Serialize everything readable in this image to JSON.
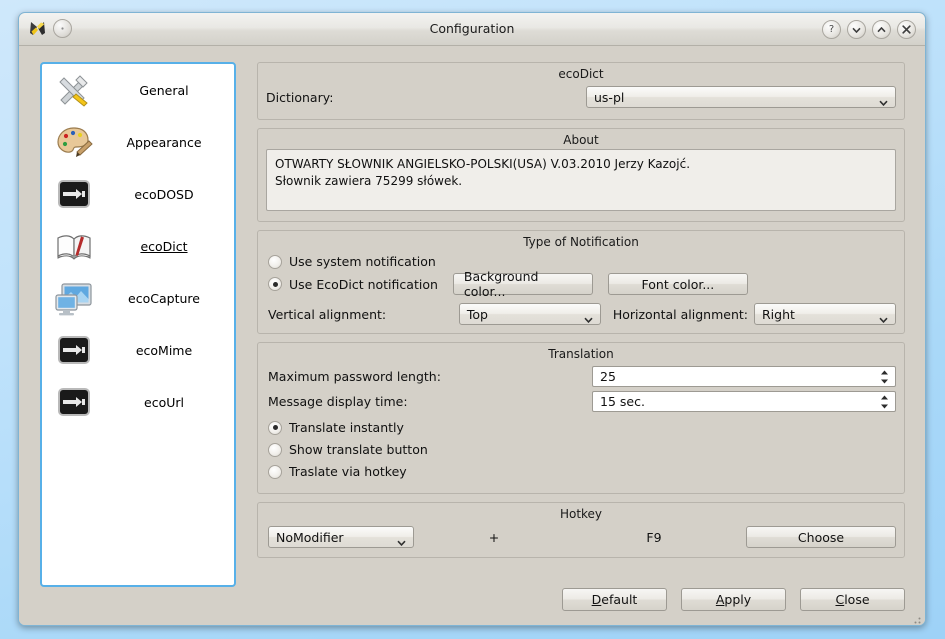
{
  "window": {
    "title": "Configuration",
    "titlebar_buttons": [
      {
        "name": "help-button",
        "glyph": "?"
      },
      {
        "name": "minimize-button",
        "glyph": "⌄"
      },
      {
        "name": "maximize-button",
        "glyph": "⌃"
      },
      {
        "name": "close-button",
        "glyph": "✕"
      }
    ]
  },
  "sidebar": {
    "items": [
      {
        "label": "General",
        "icon": "tools-icon",
        "active": false
      },
      {
        "label": "Appearance",
        "icon": "palette-icon",
        "active": false
      },
      {
        "label": "ecoDOSD",
        "icon": "plug-icon",
        "active": false
      },
      {
        "label": "ecoDict",
        "icon": "book-icon",
        "active": true
      },
      {
        "label": "ecoCapture",
        "icon": "monitor-icon",
        "active": false
      },
      {
        "label": "ecoMime",
        "icon": "plug-icon",
        "active": false
      },
      {
        "label": "ecoUrl",
        "icon": "plug-icon",
        "active": false
      }
    ]
  },
  "ecodict": {
    "group_title": "ecoDict",
    "dictionary_label": "Dictionary:",
    "dictionary_value": "us-pl",
    "dictionary_options": [
      "us-pl"
    ]
  },
  "about": {
    "group_title": "About",
    "line1": "OTWARTY SŁOWNIK ANGIELSKO-POLSKI(USA) V.03.2010 Jerzy Kazojć.",
    "line2": "Słownik zawiera 75299 słówek."
  },
  "notification": {
    "group_title": "Type of Notification",
    "option_system": "Use system notification",
    "option_system_selected": false,
    "option_ecodict": "Use EcoDict notification",
    "option_ecodict_selected": true,
    "background_color_button": "Background color...",
    "font_color_button": "Font color...",
    "vertical_label": "Vertical alignment:",
    "vertical_value": "Top",
    "vertical_options": [
      "Top"
    ],
    "horizontal_label": "Horizontal alignment:",
    "horizontal_value": "Right",
    "horizontal_options": [
      "Right"
    ]
  },
  "translation": {
    "group_title": "Translation",
    "max_password_label": "Maximum password length:",
    "max_password_value": "25",
    "message_time_label": "Message display time:",
    "message_time_value": "15 sec.",
    "option_instant": "Translate instantly",
    "option_instant_selected": true,
    "option_button": "Show translate button",
    "option_button_selected": false,
    "option_hotkey": "Traslate via hotkey",
    "option_hotkey_selected": false
  },
  "hotkey": {
    "group_title": "Hotkey",
    "modifier_value": "NoModifier",
    "modifier_options": [
      "NoModifier"
    ],
    "plus": "+",
    "key_value": "F9",
    "choose_button": "Choose"
  },
  "footer": {
    "default_button": "Default",
    "default_mnemonic": "D",
    "apply_button": "Apply",
    "apply_mnemonic": "A",
    "close_button": "Close",
    "close_mnemonic": "C"
  },
  "colors": {
    "desktop": "#b9e0fa",
    "window_bg": "#d4d0c8",
    "sidebar_bg": "#ffffff",
    "sidebar_border": "#57b0e8",
    "text": "#111111"
  }
}
